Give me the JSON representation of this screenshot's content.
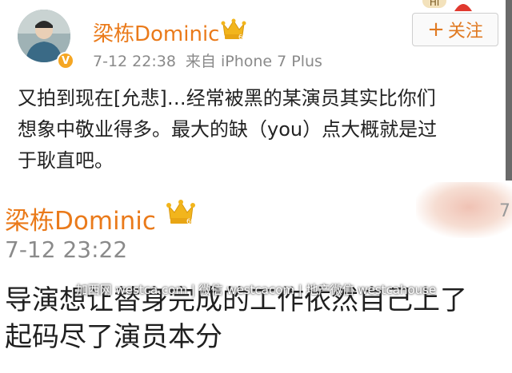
{
  "post1": {
    "author": "梁栋Dominic",
    "verified_icon": "v-badge-icon",
    "crown_icon": "crown-icon",
    "crown_level": "6",
    "time": "7-12 22:38",
    "source": "来自 iPhone 7 Plus",
    "follow_plus": "+",
    "follow_label": "关注",
    "corner_badge": "Hi",
    "text_lines": [
      "又拍到现在[允悲]…经常被黑的某演员其实比你们",
      "想象中敬业得多。最大的缺（you）点大概就是过",
      "于耿直吧。"
    ]
  },
  "post2": {
    "author": "梁栋Dominic",
    "crown_icon": "crown-icon",
    "crown_level": "6",
    "time": "7-12 23:22",
    "text_lines": [
      "导演想让替身完成的工作依然自己上了",
      "起码尽了演员本分"
    ]
  },
  "watermark": "加西网 westca.com | 微信 westcacom | 地产微信 westcahouse",
  "colors": {
    "name": "#ea7a1a",
    "meta": "#8a8a8a",
    "text": "#222222",
    "crown": "#f2b51c",
    "verified": "#f5a623"
  }
}
